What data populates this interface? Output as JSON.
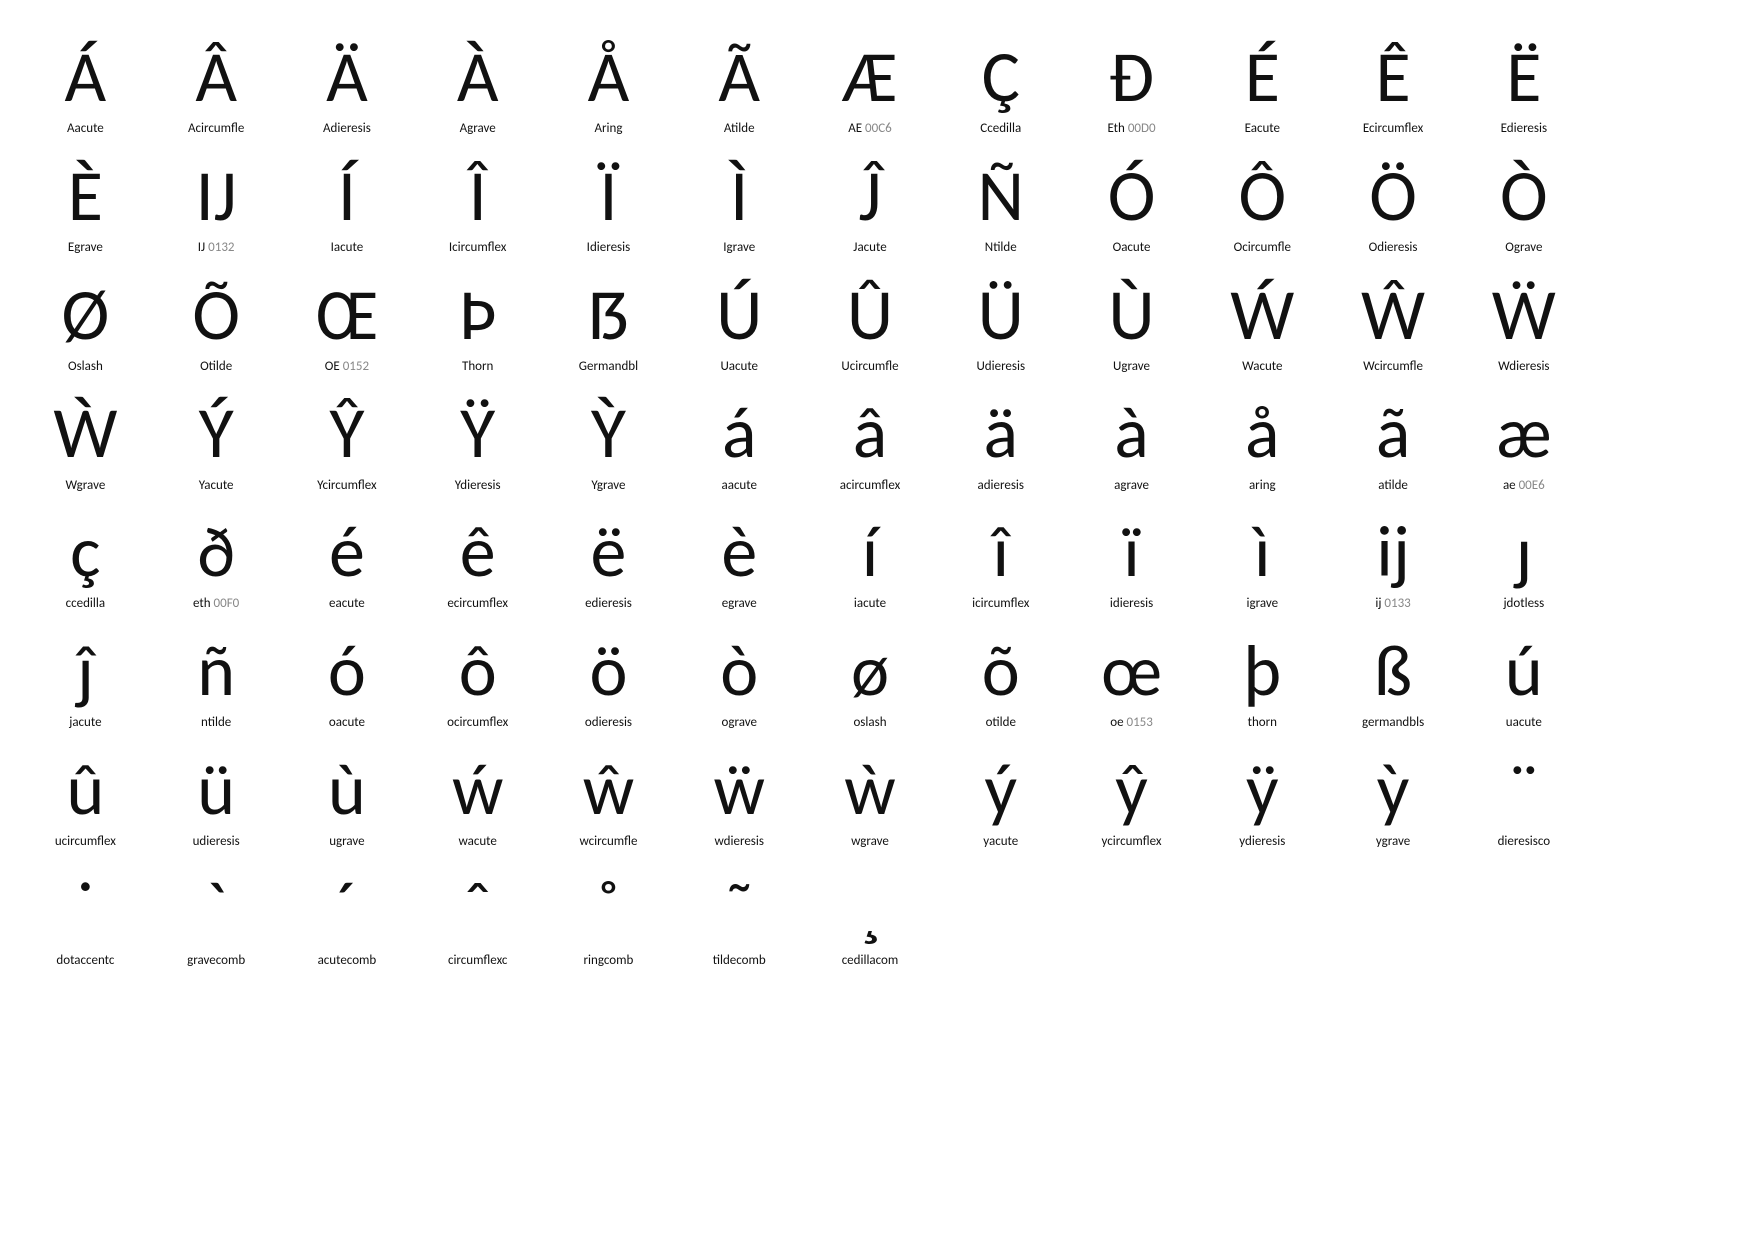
{
  "glyphs": [
    {
      "char": "Á",
      "name": "Aacute",
      "code": null
    },
    {
      "char": "Â",
      "name": "Acircumfle",
      "code": null
    },
    {
      "char": "Ä",
      "name": "Adieresis",
      "code": null
    },
    {
      "char": "À",
      "name": "Agrave",
      "code": null
    },
    {
      "char": "Å",
      "name": "Aring",
      "code": null
    },
    {
      "char": "Ã",
      "name": "Atilde",
      "code": null
    },
    {
      "char": "Æ",
      "name": "AE",
      "code": "00C6"
    },
    {
      "char": "Ç",
      "name": "Ccedilla",
      "code": null
    },
    {
      "char": "Ð",
      "name": "Eth",
      "code": "00D0"
    },
    {
      "char": "É",
      "name": "Eacute",
      "code": null
    },
    {
      "char": "Ê",
      "name": "Ecircumflex",
      "code": null
    },
    {
      "char": "Ë",
      "name": "Edieresis",
      "code": null
    },
    {
      "char": "È",
      "name": "Egrave",
      "code": null
    },
    {
      "char": "IJ",
      "name": "IJ",
      "code": "0132"
    },
    {
      "char": "Í",
      "name": "Iacute",
      "code": null
    },
    {
      "char": "Î",
      "name": "Icircumflex",
      "code": null
    },
    {
      "char": "Ï",
      "name": "Idieresis",
      "code": null
    },
    {
      "char": "Ì",
      "name": "Igrave",
      "code": null
    },
    {
      "char": "Ĵ",
      "name": "Jacute",
      "code": null
    },
    {
      "char": "Ñ",
      "name": "Ntilde",
      "code": null
    },
    {
      "char": "Ó",
      "name": "Oacute",
      "code": null
    },
    {
      "char": "Ô",
      "name": "Ocircumfle",
      "code": null
    },
    {
      "char": "Ö",
      "name": "Odieresis",
      "code": null
    },
    {
      "char": "Ò",
      "name": "Ograve",
      "code": null
    },
    {
      "char": "Ø",
      "name": "Oslash",
      "code": null
    },
    {
      "char": "Õ",
      "name": "Otilde",
      "code": null
    },
    {
      "char": "Œ",
      "name": "OE",
      "code": "0152"
    },
    {
      "char": "Þ",
      "name": "Thorn",
      "code": null
    },
    {
      "char": "Ƃ",
      "name": "Germandbl",
      "code": null
    },
    {
      "char": "Ú",
      "name": "Uacute",
      "code": null
    },
    {
      "char": "Û",
      "name": "Ucircumfle",
      "code": null
    },
    {
      "char": "Ü",
      "name": "Udieresis",
      "code": null
    },
    {
      "char": "Ù",
      "name": "Ugrave",
      "code": null
    },
    {
      "char": "Ẃ",
      "name": "Wacute",
      "code": null
    },
    {
      "char": "Ŵ",
      "name": "Wcircumfle",
      "code": null
    },
    {
      "char": "Ẅ",
      "name": "Wdieresis",
      "code": null
    },
    {
      "char": "Ẁ",
      "name": "Wgrave",
      "code": null
    },
    {
      "char": "Ý",
      "name": "Yacute",
      "code": null
    },
    {
      "char": "Ŷ",
      "name": "Ycircumflex",
      "code": null
    },
    {
      "char": "Ÿ",
      "name": "Ydieresis",
      "code": null
    },
    {
      "char": "Ỳ",
      "name": "Ygrave",
      "code": null
    },
    {
      "char": "á",
      "name": "aacute",
      "code": null
    },
    {
      "char": "â",
      "name": "acircumflex",
      "code": null
    },
    {
      "char": "ä",
      "name": "adieresis",
      "code": null
    },
    {
      "char": "à",
      "name": "agrave",
      "code": null
    },
    {
      "char": "å",
      "name": "aring",
      "code": null
    },
    {
      "char": "ã",
      "name": "atilde",
      "code": null
    },
    {
      "char": "æ",
      "name": "ae",
      "code": "00E6"
    },
    {
      "char": "ç",
      "name": "ccedilla",
      "code": null
    },
    {
      "char": "ð",
      "name": "eth",
      "code": "00F0"
    },
    {
      "char": "é",
      "name": "eacute",
      "code": null
    },
    {
      "char": "ê",
      "name": "ecircumflex",
      "code": null
    },
    {
      "char": "ë",
      "name": "edieresis",
      "code": null
    },
    {
      "char": "è",
      "name": "egrave",
      "code": null
    },
    {
      "char": "í",
      "name": "iacute",
      "code": null
    },
    {
      "char": "î",
      "name": "icircumflex",
      "code": null
    },
    {
      "char": "ï",
      "name": "idieresis",
      "code": null
    },
    {
      "char": "ì",
      "name": "igrave",
      "code": null
    },
    {
      "char": "ij",
      "name": "ij",
      "code": "0133"
    },
    {
      "char": "ȷ",
      "name": "jdotless",
      "code": null
    },
    {
      "char": "ĵ",
      "name": "jacute",
      "code": null
    },
    {
      "char": "ñ",
      "name": "ntilde",
      "code": null
    },
    {
      "char": "ó",
      "name": "oacute",
      "code": null
    },
    {
      "char": "ô",
      "name": "ocircumflex",
      "code": null
    },
    {
      "char": "ö",
      "name": "odieresis",
      "code": null
    },
    {
      "char": "ò",
      "name": "ograve",
      "code": null
    },
    {
      "char": "ø",
      "name": "oslash",
      "code": null
    },
    {
      "char": "õ",
      "name": "otilde",
      "code": null
    },
    {
      "char": "œ",
      "name": "oe",
      "code": "0153"
    },
    {
      "char": "þ",
      "name": "thorn",
      "code": null
    },
    {
      "char": "ß",
      "name": "germandbls",
      "code": null
    },
    {
      "char": "ú",
      "name": "uacute",
      "code": null
    },
    {
      "char": "û",
      "name": "ucircumflex",
      "code": null
    },
    {
      "char": "ü",
      "name": "udieresis",
      "code": null
    },
    {
      "char": "ù",
      "name": "ugrave",
      "code": null
    },
    {
      "char": "ẃ",
      "name": "wacute",
      "code": null
    },
    {
      "char": "ŵ",
      "name": "wcircumfle",
      "code": null
    },
    {
      "char": "ẅ",
      "name": "wdieresis",
      "code": null
    },
    {
      "char": "ẁ",
      "name": "wgrave",
      "code": null
    },
    {
      "char": "ý",
      "name": "yacute",
      "code": null
    },
    {
      "char": "ŷ",
      "name": "ycircumflex",
      "code": null
    },
    {
      "char": "ÿ",
      "name": "ydieresis",
      "code": null
    },
    {
      "char": "ỳ",
      "name": "ygrave",
      "code": null
    },
    {
      "char": "¨",
      "name": "dieresisco",
      "code": null
    },
    {
      "char": "˙",
      "name": "dotaccentc",
      "code": null
    },
    {
      "char": "ˋ",
      "name": "gravecomb",
      "code": null
    },
    {
      "char": "ˊ",
      "name": "acutecomb",
      "code": null
    },
    {
      "char": "ˆ",
      "name": "circumflexc",
      "code": null
    },
    {
      "char": "˚",
      "name": "ringcomb",
      "code": null
    },
    {
      "char": "˜",
      "name": "tildecomb",
      "code": null
    },
    {
      "char": "¸",
      "name": "cedillacom",
      "code": null
    }
  ]
}
